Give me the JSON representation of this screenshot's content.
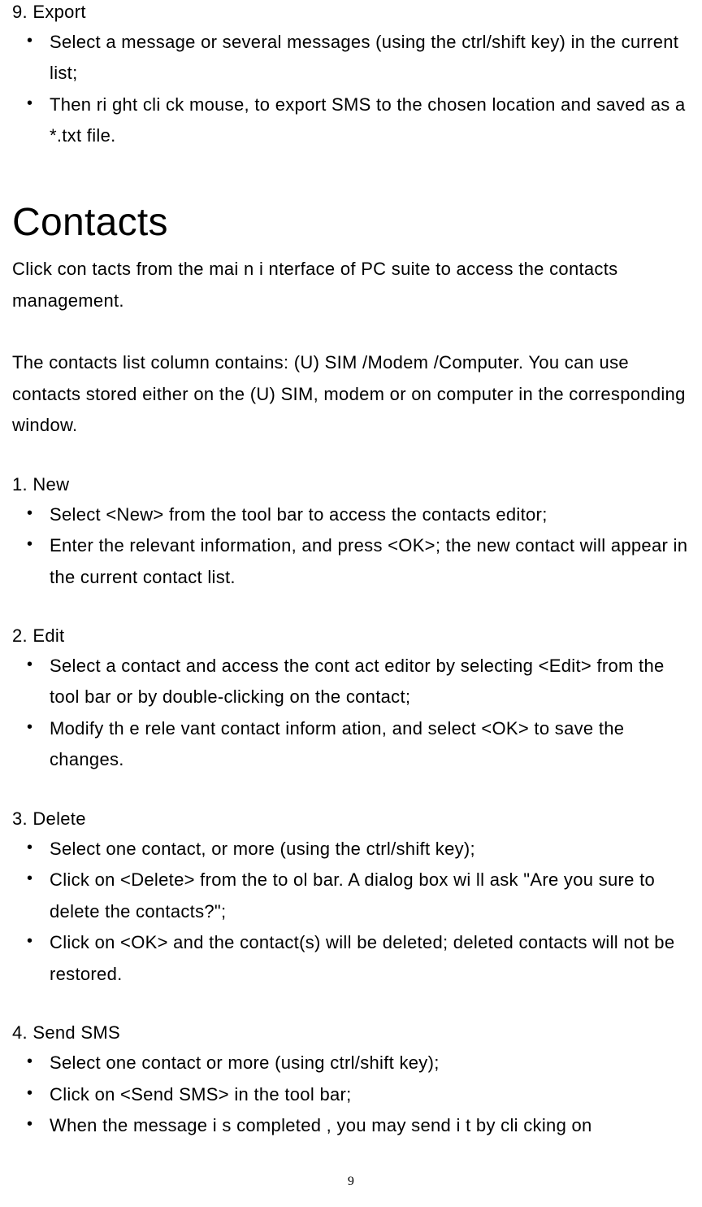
{
  "section9": {
    "title": "9. Export",
    "bullets": [
      "Select a message or several messages (using the ctrl/shift key) in the current list;",
      "Then ri ght cli ck mouse,  to export SMS to the chosen location and saved as a *.txt file."
    ]
  },
  "contacts": {
    "heading": "Contacts",
    "intro1": "Click con tacts from the mai    n i nterface of PC suite to access the contacts management.",
    "intro2": "The contacts list column contains: (U) SIM /Modem /Computer. You can use contacts stored either on the (U) SIM, modem or on computer in the corresponding window."
  },
  "section1": {
    "title": "1. New",
    "bullets": [
      "Select <New> from the tool bar to access the contacts editor;",
      "Enter the relevant information, and press <OK>; the new contact will appear in the current contact list."
    ]
  },
  "section2": {
    "title": "2. Edit",
    "bullets": [
      "Select a contact and access the cont act editor by selecting <Edit> from the tool bar or by double-clicking on the contact;",
      "Modify th e rele vant contact inform ation, and select <OK> to save the changes."
    ]
  },
  "section3": {
    "title": "3. Delete",
    "bullets": [
      "Select one contact, or more (using the ctrl/shift key);",
      "Click on <Delete> from the to ol bar. A  dialog box wi ll ask \"Are you sure to delete the contacts?\";",
      "Click on <OK> and the contact(s) will be deleted; deleted contacts will not be restored."
    ]
  },
  "section4": {
    "title": "4. Send SMS",
    "bullets": [
      "Select one contact or more (using ctrl/shift key);",
      "Click on <Send SMS> in the tool bar;",
      "When the  message i s completed , you may send i  t by cli cking on"
    ]
  },
  "pageNumber": "9"
}
